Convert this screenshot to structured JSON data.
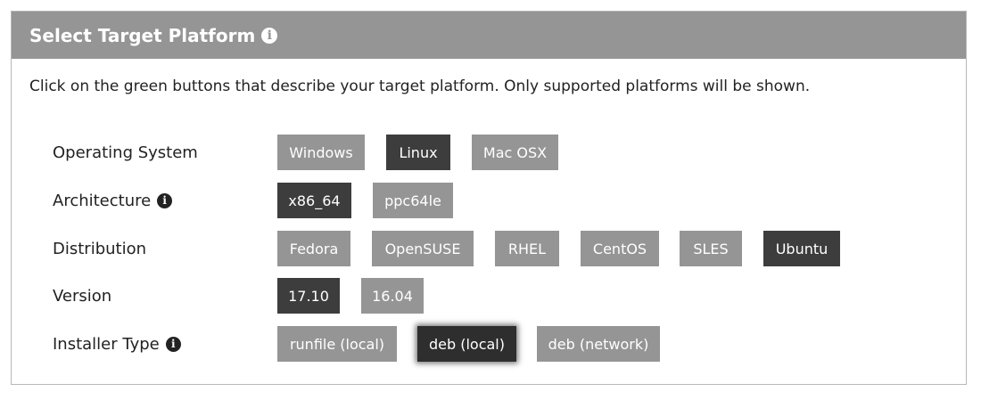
{
  "header": {
    "title": "Select Target Platform",
    "info_icon": "info-circle-icon"
  },
  "instructions": "Click on the green buttons that describe your target platform. Only supported platforms will be shown.",
  "rows": [
    {
      "label": "Operating System",
      "has_info": false,
      "options": [
        "Windows",
        "Linux",
        "Mac OSX"
      ],
      "selected": "Linux"
    },
    {
      "label": "Architecture",
      "has_info": true,
      "options": [
        "x86_64",
        "ppc64le"
      ],
      "selected": "x86_64"
    },
    {
      "label": "Distribution",
      "has_info": false,
      "options": [
        "Fedora",
        "OpenSUSE",
        "RHEL",
        "CentOS",
        "SLES",
        "Ubuntu"
      ],
      "selected": "Ubuntu"
    },
    {
      "label": "Version",
      "has_info": false,
      "options": [
        "17.10",
        "16.04"
      ],
      "selected": "17.10"
    },
    {
      "label": "Installer Type",
      "has_info": true,
      "options": [
        "runfile (local)",
        "deb (local)",
        "deb (network)"
      ],
      "selected": "deb (local)"
    }
  ],
  "colors": {
    "header_bg": "#959595",
    "button_default": "#959595",
    "button_selected": "#3d3d3d",
    "text": "#222222"
  }
}
